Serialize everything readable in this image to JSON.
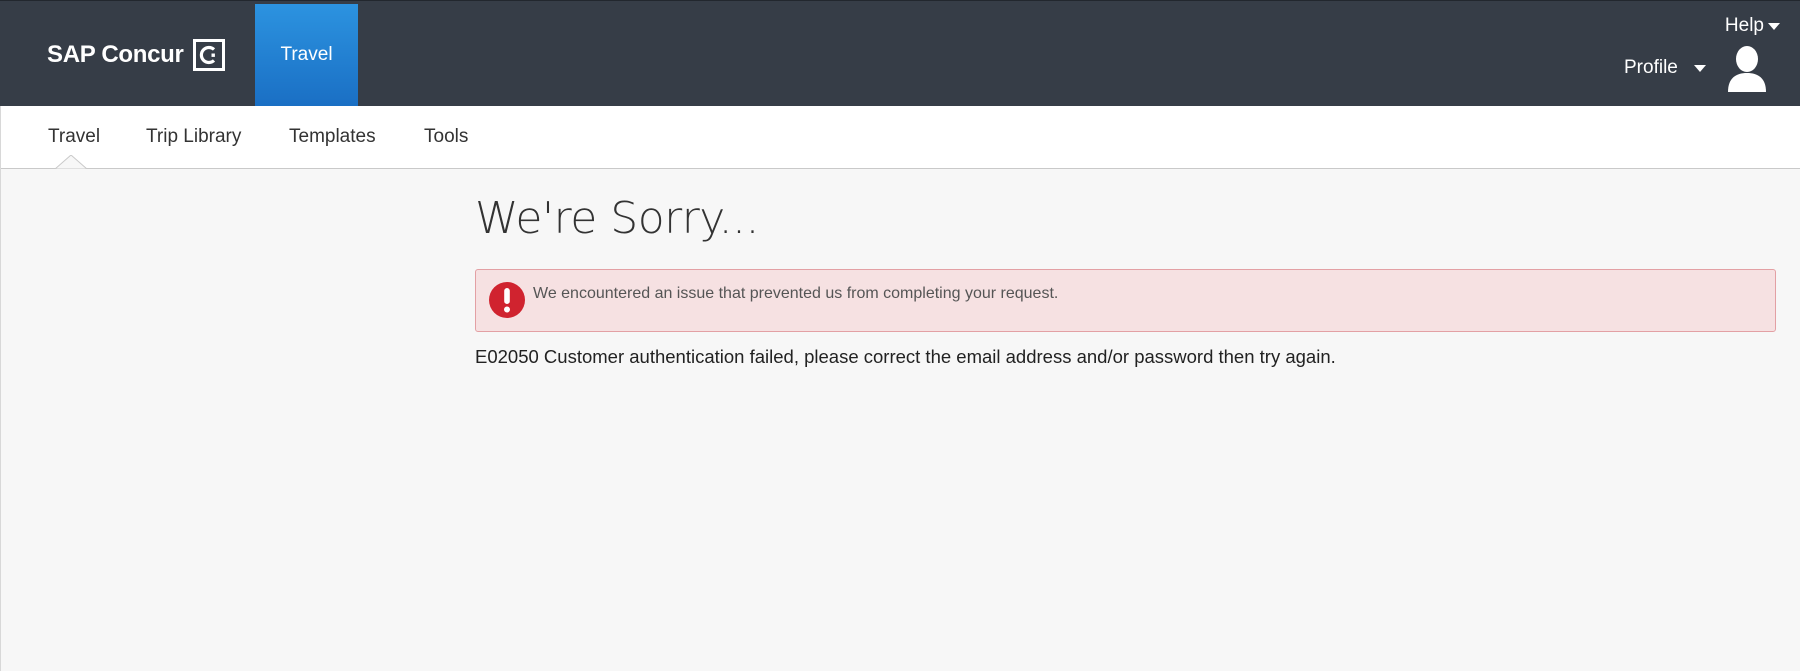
{
  "header": {
    "brand": "SAP Concur",
    "brand_mark_letter": "C",
    "app_tab": "Travel",
    "help_label": "Help",
    "profile_label": "Profile"
  },
  "subnav": {
    "items": [
      "Travel",
      "Trip Library",
      "Templates",
      "Tools"
    ],
    "active": "Travel"
  },
  "main": {
    "title": "We're Sorry...",
    "alert_message": "We encountered an issue that prevented us from completing your request.",
    "alert_icon_glyph": "!",
    "error_detail": "E02050 Customer authentication failed, please correct the email address and/or password then try again."
  },
  "colors": {
    "header_bg": "#363d47",
    "app_tab_bg": "#1f7fd3",
    "alert_bg": "#f6e1e2",
    "alert_border": "#e3a0a4",
    "alert_icon": "#d0232f",
    "page_bg": "#f7f7f7"
  },
  "icons": [
    "concur-logo-icon",
    "caret-down-icon",
    "user-avatar-icon",
    "error-exclamation-icon"
  ]
}
